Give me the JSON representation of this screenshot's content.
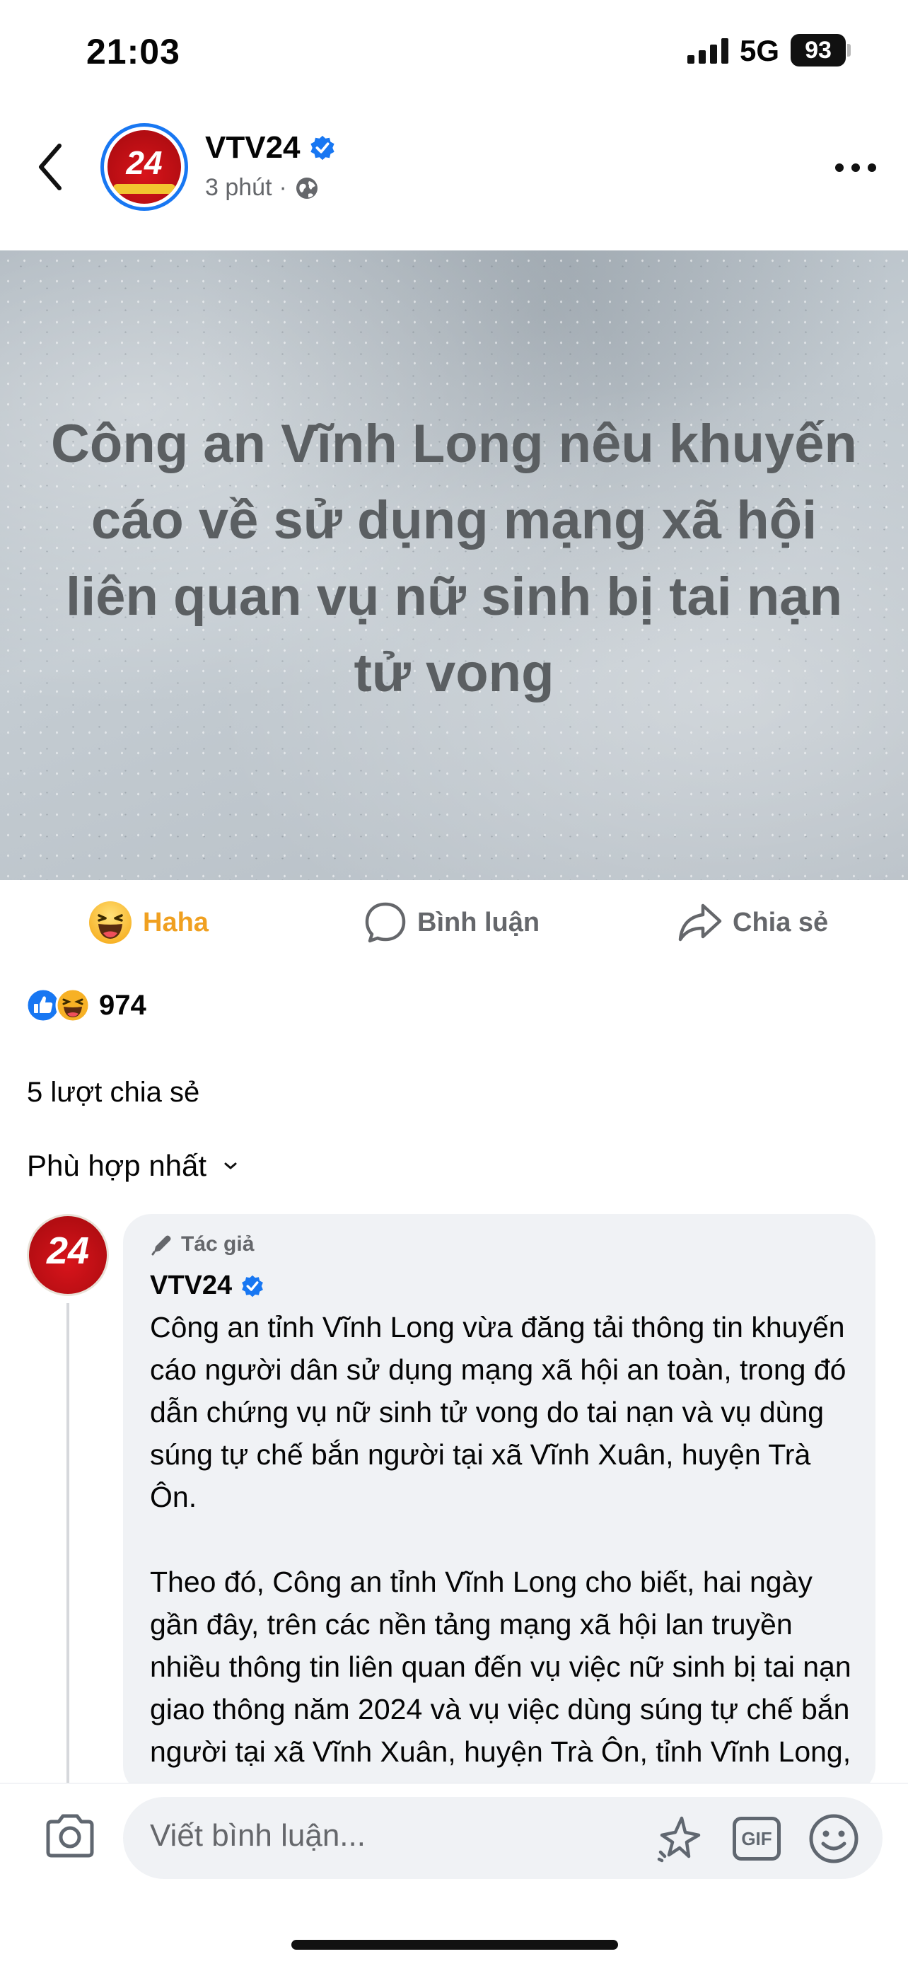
{
  "status_bar": {
    "time": "21:03",
    "network": "5G",
    "battery": "93"
  },
  "header": {
    "page_name": "VTV24",
    "avatar_text": "24",
    "time_ago": "3 phút",
    "separator": "·",
    "icons": {
      "back": "chevron-left-icon",
      "verified": "verified-badge-icon",
      "privacy": "globe-icon",
      "more": "more-horizontal-icon"
    }
  },
  "post": {
    "image_headline": "Công an Vĩnh Long nêu khuyến cáo về sử dụng mạng xã hội liên quan vụ nữ sinh bị tai nạn tử vong"
  },
  "actions": {
    "reaction_label": "Haha",
    "comment_label": "Bình luận",
    "share_label": "Chia sẻ"
  },
  "reactions": {
    "count": "974",
    "types": [
      "like",
      "haha"
    ]
  },
  "shares_text": "5 lượt chia sẻ",
  "sort": {
    "label": "Phù hợp nhất"
  },
  "comment": {
    "author_badge": "Tác giả",
    "author": "VTV24",
    "avatar_text": "24",
    "paragraphs": [
      "Công an tỉnh Vĩnh Long vừa đăng tải thông tin khuyến cáo người dân sử dụng mạng xã hội an toàn, trong đó dẫn chứng vụ nữ sinh tử vong do tai nạn và vụ dùng súng tự chế bắn người tại xã Vĩnh Xuân, huyện Trà Ôn.",
      "Theo đó, Công an tỉnh Vĩnh Long cho biết, hai ngày gần đây, trên các nền tảng mạng xã hội lan truyền nhiều thông tin liên quan đến vụ việc nữ sinh bị tai nạn giao thông năm 2024 và vụ việc dùng súng tự chế bắn người tại xã Vĩnh Xuân, huyện Trà Ôn, tỉnh Vĩnh Long, gây bức xúc trong dư luận."
    ]
  },
  "composer": {
    "placeholder": "Viết bình luận...",
    "gif_label": "GIF"
  },
  "colors": {
    "accent": "#1877f2",
    "haha": "#f0a020",
    "muted": "#65676b",
    "bubble": "#f0f2f5",
    "brand_red": "#c8101a"
  }
}
